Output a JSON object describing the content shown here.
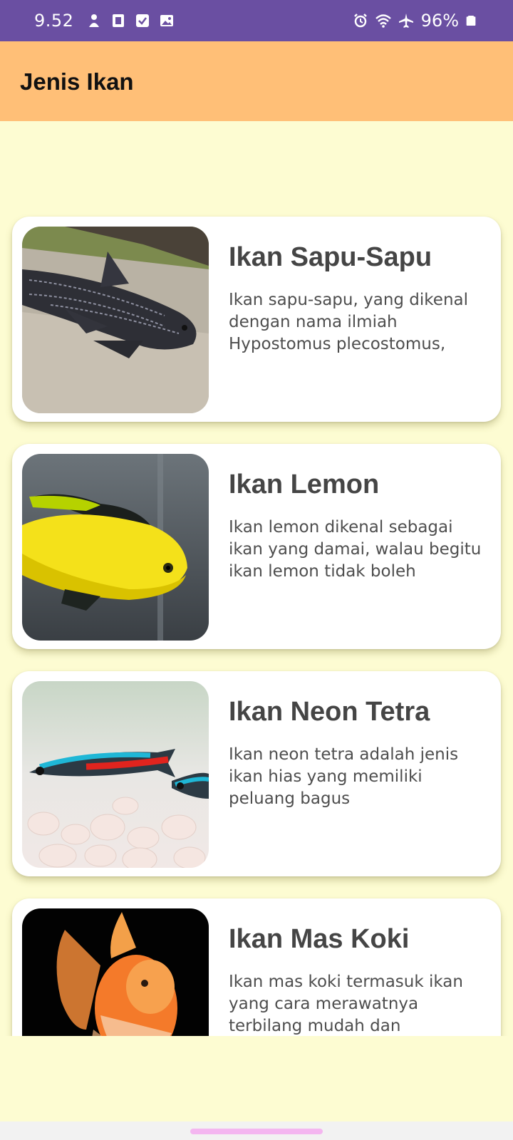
{
  "status_bar": {
    "time": "9.52",
    "battery": "96%",
    "left_icons": [
      "notification-icon",
      "sim-icon",
      "checkbox-icon",
      "gallery-icon"
    ],
    "right_icons": [
      "alarm-icon",
      "wifi-icon",
      "airplane-icon",
      "battery-icon"
    ]
  },
  "app_bar": {
    "title": "Jenis Ikan",
    "background": "#FFBF77"
  },
  "colors": {
    "status_bar": "#6A4FA2",
    "page_background": "#FDFCD2",
    "card_background": "#FFFFFF",
    "title_text": "#454545",
    "nav_handle": "#F4B6F0"
  },
  "fish_list": [
    {
      "title": "Ikan Sapu-Sapu",
      "description": "Ikan sapu-sapu, yang dikenal dengan nama ilmiah Hypostomus plecostomus,"
    },
    {
      "title": "Ikan Lemon",
      "description": "Ikan lemon dikenal sebagai ikan yang damai, walau begitu ikan lemon tidak boleh"
    },
    {
      "title": "Ikan Neon Tetra",
      "description": "Ikan neon tetra adalah jenis ikan hias yang memiliki peluang bagus"
    },
    {
      "title": "Ikan Mas Koki",
      "description": "Ikan mas koki termasuk ikan yang cara merawatnya terbilang mudah dan"
    }
  ]
}
